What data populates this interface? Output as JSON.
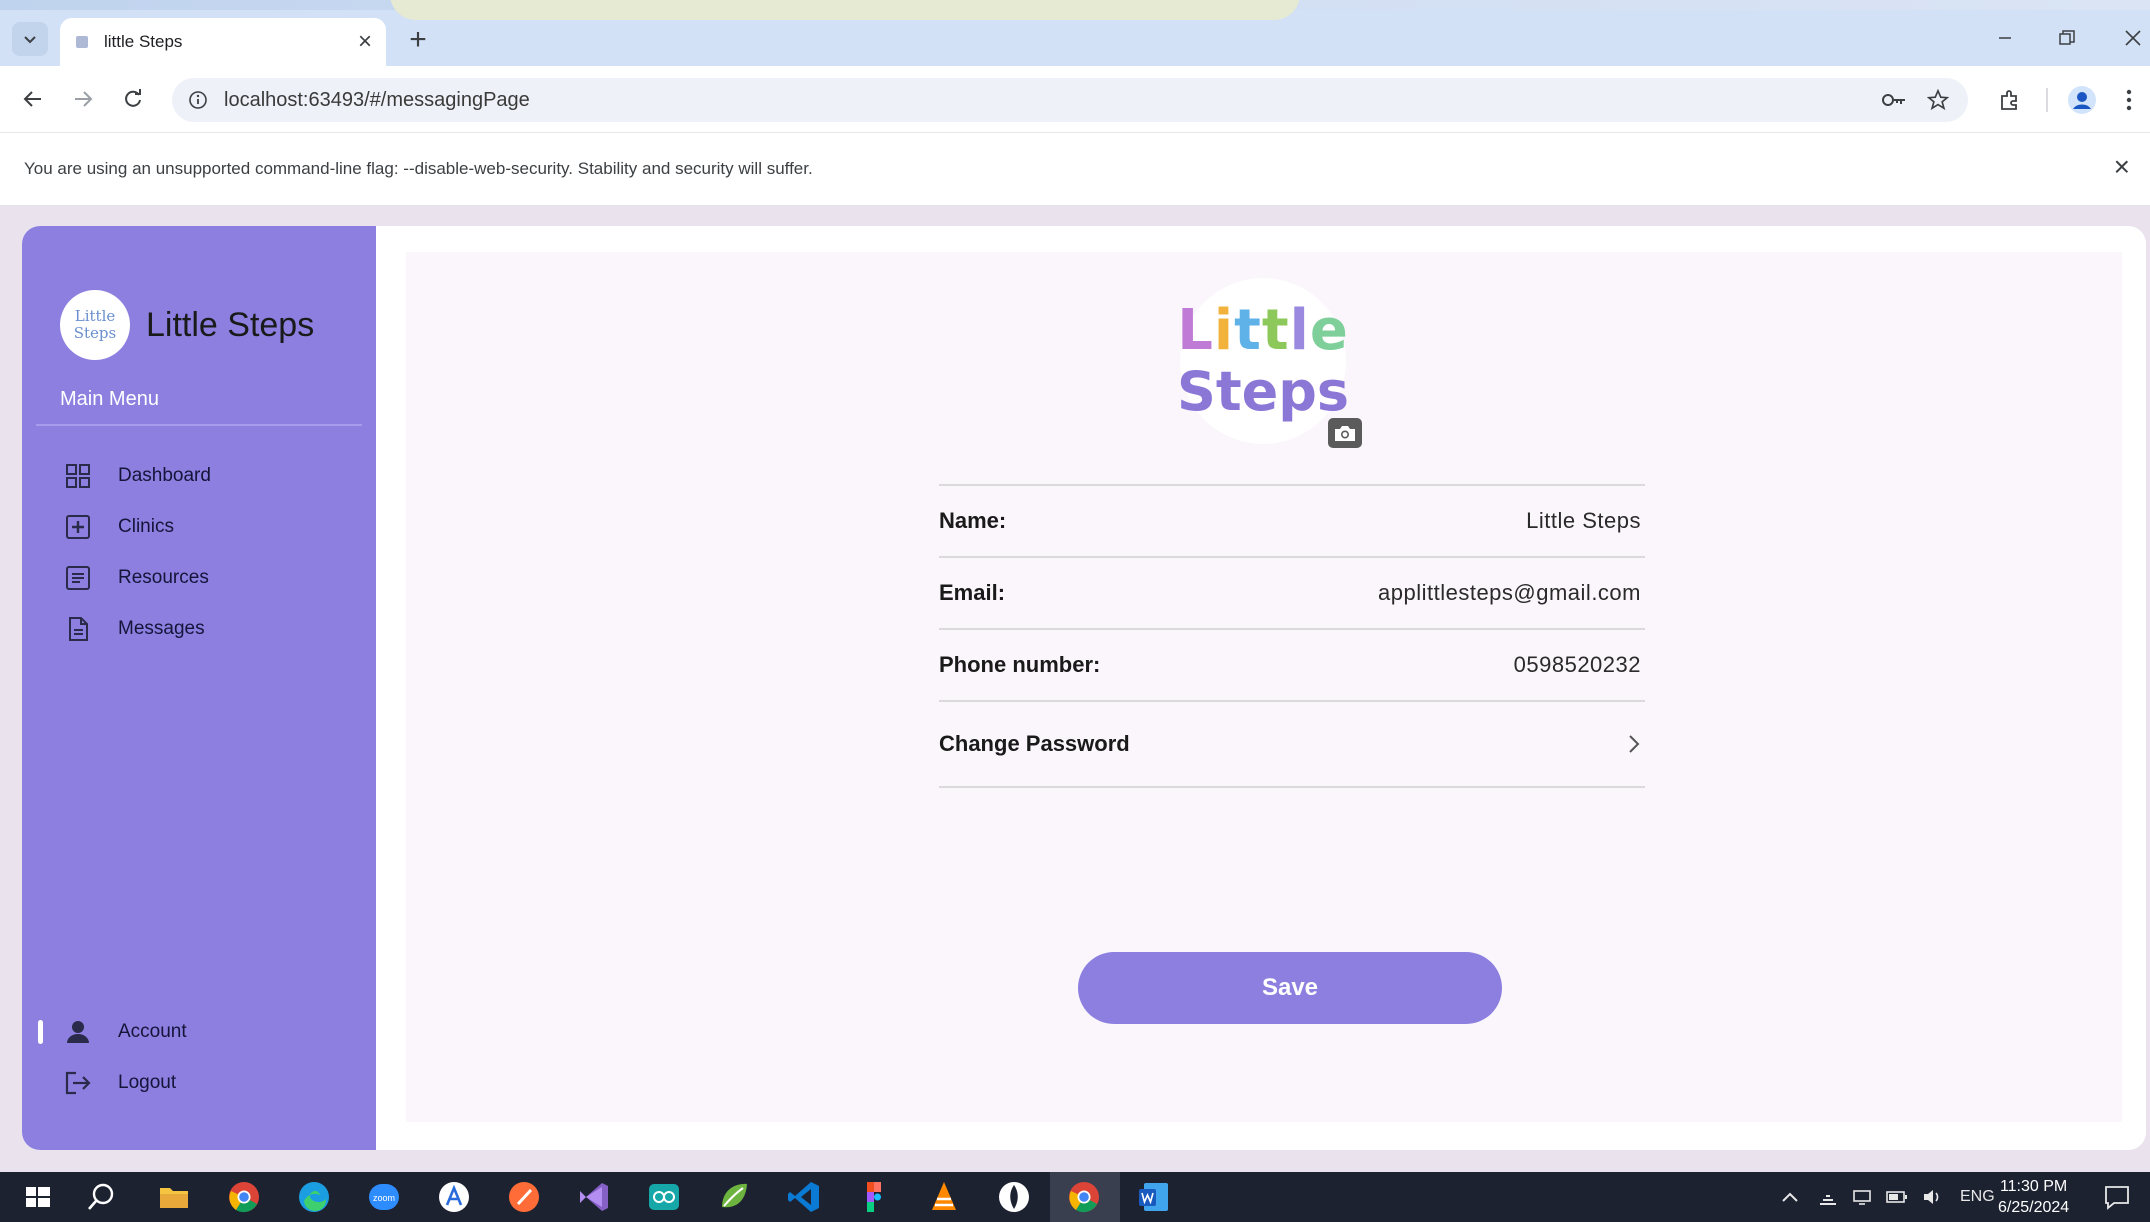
{
  "browser": {
    "tab_title": "little Steps",
    "url": "localhost:63493/#/messagingPage",
    "infobar_message": "You are using an unsupported command-line flag: --disable-web-security. Stability and security will suffer."
  },
  "sidebar": {
    "brand_name": "Little Steps",
    "logo_line1": "Little",
    "logo_line2": "Steps",
    "menu_heading": "Main Menu",
    "items": [
      {
        "label": "Dashboard",
        "icon": "dashboard-grid-icon"
      },
      {
        "label": "Clinics",
        "icon": "plus-box-icon"
      },
      {
        "label": "Resources",
        "icon": "list-document-icon"
      },
      {
        "label": "Messages",
        "icon": "file-icon"
      }
    ],
    "bottom_items": [
      {
        "label": "Account",
        "icon": "person-icon",
        "active": true
      },
      {
        "label": "Logout",
        "icon": "logout-icon"
      }
    ]
  },
  "profile": {
    "avatar_word1": "Little",
    "avatar_word2": "Steps",
    "fields": [
      {
        "label": "Name:",
        "value": "Little Steps"
      },
      {
        "label": "Email:",
        "value": "applittlesteps@gmail.com"
      },
      {
        "label": "Phone number:",
        "value": "0598520232"
      }
    ],
    "change_password_label": "Change Password",
    "save_label": "Save"
  },
  "taskbar": {
    "language": "ENG",
    "time": "11:30 PM",
    "date": "6/25/2024"
  },
  "colors": {
    "accent": "#8c7fe0",
    "card_background": "#fbf6fc"
  }
}
